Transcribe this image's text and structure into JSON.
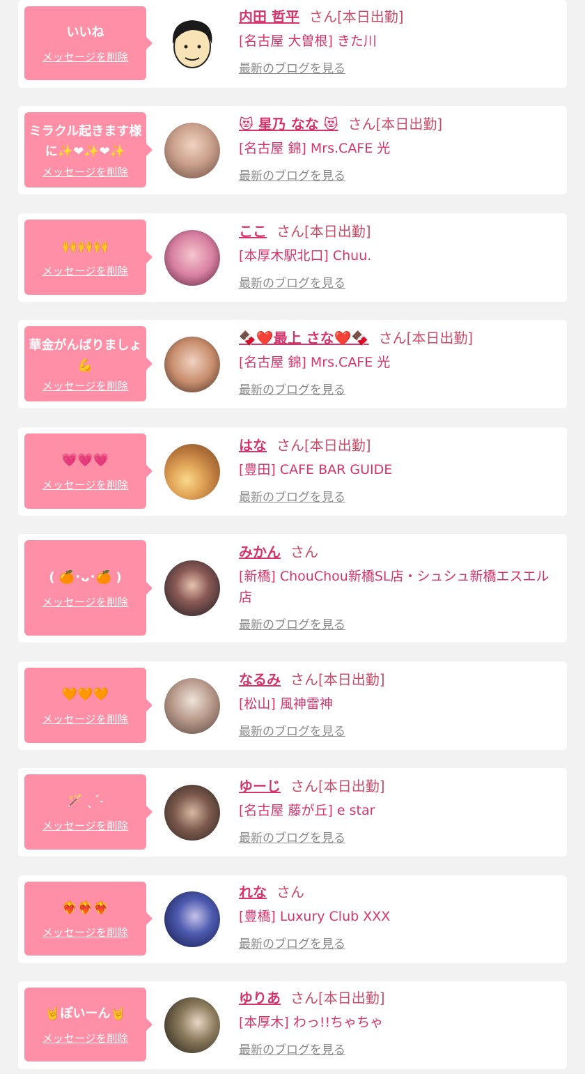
{
  "labels": {
    "delete": "メッセージを削除",
    "blog": "最新のブログを見る",
    "honorific": "さん"
  },
  "messages": [
    {
      "message": "いいね",
      "name": "内田 哲平",
      "status": "[本日出勤]",
      "shop": "[名古屋 大曽根] きた川",
      "avatar": "cartoon-man"
    },
    {
      "message": "ミラクル起きます様に✨❤✨❤✨",
      "name": "😻 星乃 なな 😻",
      "status": "[本日出勤]",
      "shop": "[名古屋 錦] Mrs.CAFE 光",
      "avatar": "photo-woman"
    },
    {
      "message": "🙌🙌🙌",
      "name": "ここ",
      "status": "[本日出勤]",
      "shop": "[本厚木駅北口] Chuu.",
      "avatar": "photo-woman"
    },
    {
      "message": "華金がんばりましょ💪",
      "name": "🍫❤️最上 さな❤️🍫",
      "status": "[本日出勤]",
      "shop": "[名古屋 錦] Mrs.CAFE 光",
      "avatar": "photo-woman"
    },
    {
      "message": "💗💗💗",
      "name": "はな",
      "status": "[本日出勤]",
      "shop": "[豊田] CAFE BAR GUIDE",
      "avatar": "photo-woman"
    },
    {
      "message": "( 🍊･ᴗ･🍊 )",
      "name": "みかん",
      "status": "",
      "shop": "[新橋] ChouChou新橋SL店・シュシュ新橋エスエル店",
      "avatar": "photo-woman"
    },
    {
      "message": "🧡🧡🧡",
      "name": "なるみ",
      "status": "[本日出勤]",
      "shop": "[松山] 風神雷神",
      "avatar": "photo-woman"
    },
    {
      "message": "🪄 ˎˊ˗",
      "name": "ゆーじ",
      "status": "[本日出勤]",
      "shop": "[名古屋 藤が丘] e star",
      "avatar": "photo-man"
    },
    {
      "message": "❤️‍🔥❤️‍🔥❤️‍🔥",
      "name": "れな",
      "status": "",
      "shop": "[豊橋] Luxury Club XXX",
      "avatar": "photo-woman"
    },
    {
      "message": "🤘ぽいーん🤘",
      "name": "ゆりあ",
      "status": "[本日出勤]",
      "shop": "[本厚木] わっ!!ちゃちゃ",
      "avatar": "photo-woman"
    }
  ]
}
